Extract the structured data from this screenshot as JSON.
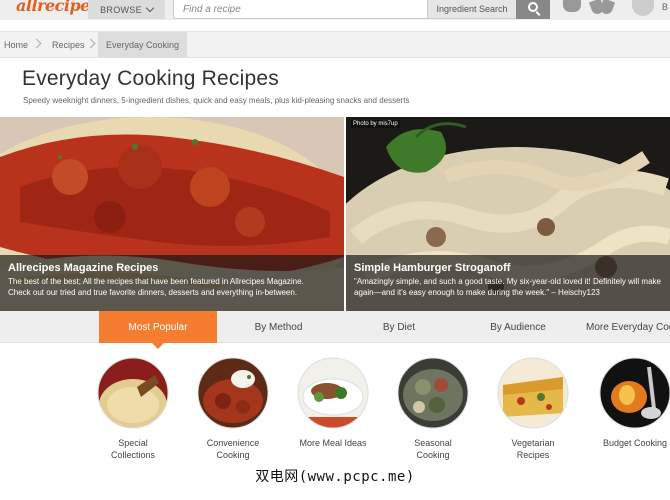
{
  "header": {
    "logo": "allrecipes!",
    "browse_label": "BROWSE",
    "search_placeholder": "Find a recipe",
    "ingredient_search_label": "Ingredient Search",
    "user_initial": "B"
  },
  "breadcrumb": [
    {
      "label": "Home"
    },
    {
      "label": "Recipes"
    },
    {
      "label": "Everyday Cooking"
    }
  ],
  "page": {
    "title": "Everyday Cooking Recipes",
    "subtitle": "Speedy weeknight dinners, 5-ingredient dishes, quick and easy meals, plus kid-pleasing snacks and desserts"
  },
  "heroes": [
    {
      "title": "Allrecipes Magazine Recipes",
      "description": "The best of the best; All the recipes that have been featured in Allrecipes Magazine.\nCheck out our tried and true favorite dinners, desserts and everything in-between.",
      "credit": ""
    },
    {
      "title": "Simple Hamburger Stroganoff",
      "description": "\"Amazingly simple, and such a good taste. My six-year-old loved it! Definitely will make\nagain—and it's easy enough to make during the week.\" – Heischy123",
      "credit": "Photo by mis7up"
    }
  ],
  "tabs": [
    {
      "label": "Most Popular",
      "active": true
    },
    {
      "label": "By Method",
      "active": false
    },
    {
      "label": "By Diet",
      "active": false
    },
    {
      "label": "By Audience",
      "active": false
    },
    {
      "label": "More Everyday Cooking",
      "active": false
    }
  ],
  "categories": [
    {
      "label": "Special\nCollections",
      "icon": "special-collections-thumbnail"
    },
    {
      "label": "Convenience\nCooking",
      "icon": "convenience-cooking-thumbnail"
    },
    {
      "label": "More Meal Ideas",
      "icon": "more-meal-ideas-thumbnail"
    },
    {
      "label": "Seasonal\nCooking",
      "icon": "seasonal-cooking-thumbnail"
    },
    {
      "label": "Vegetarian\nRecipes",
      "icon": "vegetarian-recipes-thumbnail"
    },
    {
      "label": "Budget Cooking",
      "icon": "budget-cooking-thumbnail"
    }
  ],
  "watermark": "双电网(www.pcpc.me)",
  "colors": {
    "brand": "#e35e1f",
    "active_tab": "#f47d31"
  }
}
